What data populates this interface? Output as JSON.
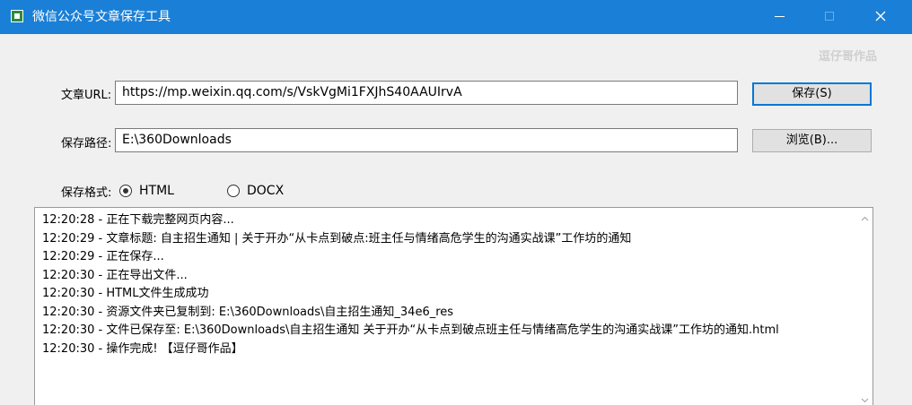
{
  "window": {
    "title": "微信公众号文章保存工具",
    "watermark": "逗仔哥作品"
  },
  "form": {
    "url_label": "文章URL:",
    "url_value": "https://mp.weixin.qq.com/s/VskVgMi1FXJhS40AAUIrvA",
    "save_button": "保存(S)",
    "path_label": "保存路径:",
    "path_value": "E:\\360Downloads",
    "browse_button": "浏览(B)...",
    "format_label": "保存格式:",
    "formats": [
      {
        "label": "HTML",
        "selected": true
      },
      {
        "label": "DOCX",
        "selected": false
      }
    ]
  },
  "log": {
    "lines": [
      "12:20:28 - 正在下载完整网页内容...",
      "12:20:29 - 文章标题: 自主招生通知 | 关于开办“从卡点到破点:班主任与情绪高危学生的沟通实战课”工作坊的通知",
      "12:20:29 - 正在保存...",
      "12:20:30 - 正在导出文件...",
      "12:20:30 - HTML文件生成成功",
      "12:20:30 - 资源文件夹已复制到: E:\\360Downloads\\自主招生通知_34e6_res",
      "12:20:30 - 文件已保存至: E:\\360Downloads\\自主招生通知 关于开办“从卡点到破点班主任与情绪高危学生的沟通实战课”工作坊的通知.html",
      "12:20:30 - 操作完成! 【逗仔哥作品】"
    ]
  },
  "colors": {
    "titlebar": "#1a7fd6",
    "window_bg": "#f0f0f0",
    "default_button_border": "#0078d7"
  }
}
